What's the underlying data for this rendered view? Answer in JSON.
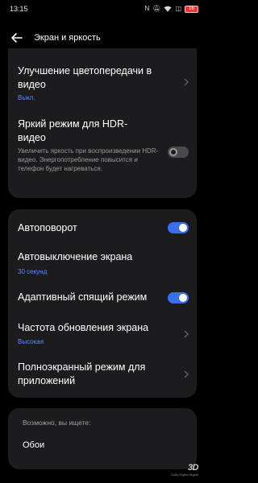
{
  "status_bar": {
    "time": "13:15",
    "icons": [
      "nfc-icon",
      "mute-icon",
      "wifi-icon",
      "hd-icon",
      "battery-icon"
    ],
    "battery_level": "16"
  },
  "header": {
    "title": "Экран и яркость"
  },
  "section_display": {
    "color_enhance": {
      "title": "Улучшение цветопередачи в видео",
      "value": "Выкл."
    },
    "hdr_bright": {
      "title": "Яркий режим для HDR-видео",
      "description": "Увеличить яркость при воспроизведении HDR-видео. Энергопотребление повысится и телефон будет нагреваться.",
      "enabled": false
    }
  },
  "section_screen": {
    "autorotate": {
      "title": "Автоповорот",
      "enabled": true
    },
    "auto_off": {
      "title": "Автовыключение экрана",
      "value": "30 секунд"
    },
    "adaptive_sleep": {
      "title": "Адаптивный спящий режим",
      "enabled": true
    },
    "refresh_rate": {
      "title": "Частота обновления экрана",
      "value": "Высокая"
    },
    "fullscreen": {
      "title": "Полноэкранный режим для приложений"
    }
  },
  "suggestions": {
    "header": "Возможно, вы ищете:",
    "items": [
      "Обои"
    ]
  },
  "watermark": {
    "logo": "3D",
    "sub": "Daily Digital Digest"
  },
  "colors": {
    "accent": "#3b6df0",
    "link": "#5b8cf5",
    "card": "#1c1c1e",
    "background": "#000000"
  }
}
